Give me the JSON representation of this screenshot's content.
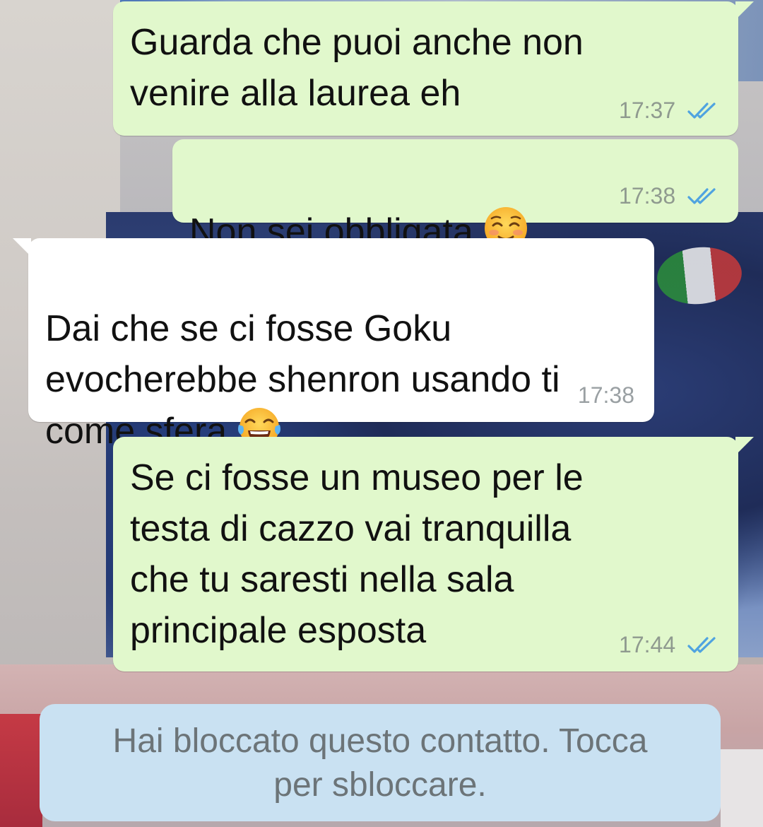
{
  "messages": [
    {
      "direction": "outgoing",
      "text": "Guarda che puoi anche non\nvenire alla laurea eh",
      "time": "17:37",
      "status_icon": "double-check-read-icon"
    },
    {
      "direction": "outgoing",
      "text": "Non sei obbligata",
      "emoji": "smiling-face-with-smiling-eyes-emoji",
      "time": "17:38",
      "status_icon": "double-check-read-icon"
    },
    {
      "direction": "incoming",
      "text": "Dai che se ci fosse Goku\nevocherebbe shenron usando ti\ncome sfera",
      "emoji": "face-with-tears-of-joy-emoji",
      "time": "17:38"
    },
    {
      "direction": "outgoing",
      "text": "Se ci fosse un museo per le\ntesta di cazzo vai tranquilla\nche tu saresti nella sala\nprincipale esposta",
      "time": "17:44",
      "status_icon": "double-check-read-icon"
    }
  ],
  "blocked_notice": "Hai bloccato questo contatto. Tocca\nper sbloccare.",
  "colors": {
    "outgoing_bubble": "#e1f8cc",
    "incoming_bubble": "#ffffff",
    "read_ticks": "#4fa3e0",
    "blocked_banner": "#c9e1f2"
  }
}
